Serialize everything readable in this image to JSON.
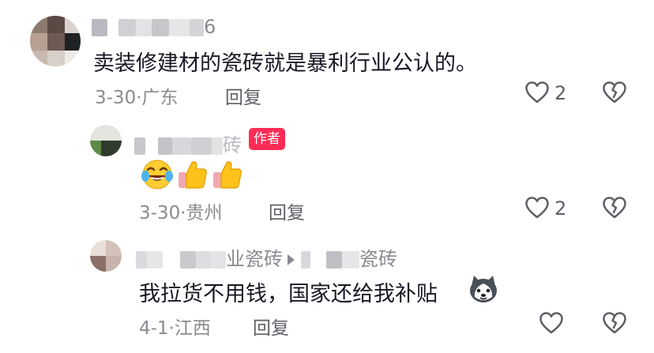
{
  "comments": [
    {
      "user_name_tail": "6",
      "text": "卖装修建材的瓷砖就是暴利行业公认的。",
      "date": "3-30",
      "location": "广东",
      "reply_label": "回复",
      "like_count": "2"
    },
    {
      "user_name_tail": "砖",
      "author_badge": "作者",
      "date": "3-30",
      "location": "贵州",
      "reply_label": "回复",
      "like_count": "2"
    },
    {
      "user_name_mid": "业瓷砖",
      "reply_to_tail": "瓷砖",
      "text": "我拉货不用钱，国家还给我补贴",
      "date": "4-1",
      "location": "江西",
      "reply_label": "回复"
    }
  ],
  "separator": "·",
  "colors": {
    "badge": "#fe2c55",
    "muted": "#8a8b91",
    "text": "#161823"
  },
  "icons": [
    "heart-outline-icon",
    "broken-heart-icon",
    "laughing-tears-emoji",
    "thumbs-up-emoji",
    "husky-dog-emoji"
  ]
}
